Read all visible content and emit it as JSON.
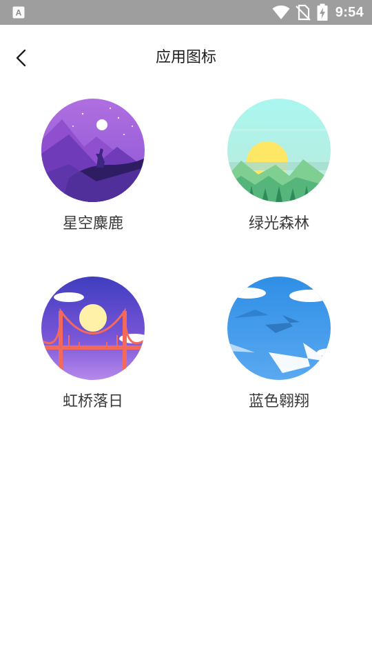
{
  "status_bar": {
    "time": "9:54",
    "icons": [
      "notification-app-icon",
      "wifi-icon",
      "no-sim-icon",
      "battery-charging-icon"
    ]
  },
  "header": {
    "title": "应用图标",
    "back_icon": "chevron-left-icon"
  },
  "icons": [
    {
      "label": "星空麋鹿",
      "theme": "starry-deer",
      "colors": [
        "#9b59d6",
        "#6a3fc0",
        "#4a2a8f"
      ]
    },
    {
      "label": "绿光森林",
      "theme": "green-forest",
      "colors": [
        "#a8f5ef",
        "#ffe066",
        "#5dbf7a"
      ]
    },
    {
      "label": "虹桥落日",
      "theme": "bridge-sunset",
      "colors": [
        "#4c3fbf",
        "#fff3a0",
        "#f0645a"
      ]
    },
    {
      "label": "蓝色翱翔",
      "theme": "blue-flight",
      "colors": [
        "#2f8fe6",
        "#ffffff",
        "#3a7bd5"
      ]
    }
  ]
}
